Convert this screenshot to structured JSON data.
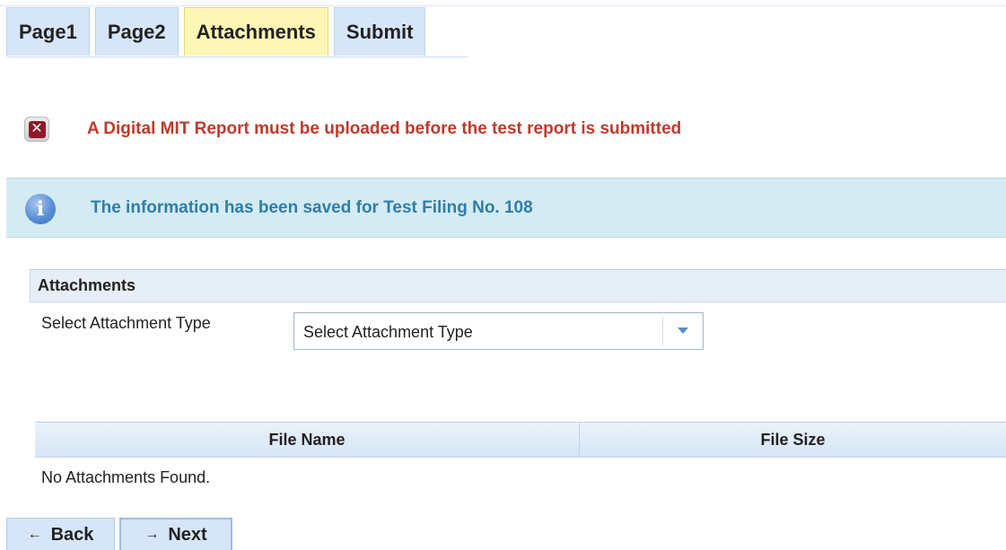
{
  "tabs": [
    {
      "label": "Page1",
      "active": false
    },
    {
      "label": "Page2",
      "active": false
    },
    {
      "label": "Attachments",
      "active": true
    },
    {
      "label": "Submit",
      "active": false
    }
  ],
  "error": {
    "icon": "error-x-icon",
    "message": "A Digital MIT Report must be uploaded before the test report is submitted",
    "color": "#c0392b"
  },
  "info": {
    "icon": "info-icon",
    "glyph": "i",
    "message": "The information has been saved for Test Filing No. 108",
    "color": "#2f7ea8"
  },
  "attachments": {
    "panel_title": "Attachments",
    "select_label": "Select Attachment Type",
    "select_value": "Select Attachment Type"
  },
  "table": {
    "columns": [
      "File Name",
      "File Size"
    ],
    "rows": [],
    "empty_message": "No Attachments Found."
  },
  "buttons": {
    "back_arrow": "←",
    "back_label": "Back",
    "next_arrow": "→",
    "next_label": "Next"
  },
  "colors": {
    "tab_bg": "#d6e6f8",
    "tab_active_bg": "#fef6b5",
    "info_banner_bg": "#d4ebf3"
  }
}
